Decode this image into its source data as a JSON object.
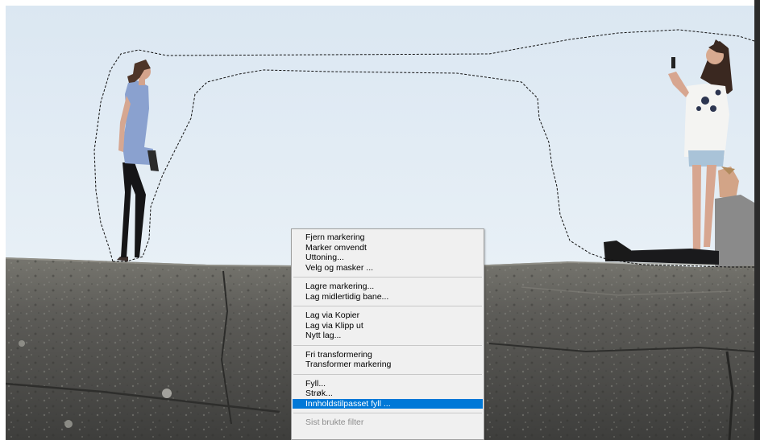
{
  "context_menu": {
    "groups": [
      {
        "items": [
          {
            "label": "Fjern markering"
          },
          {
            "label": "Marker omvendt"
          },
          {
            "label": "Uttoning..."
          },
          {
            "label": "Velg og masker ..."
          }
        ]
      },
      {
        "items": [
          {
            "label": "Lagre markering..."
          },
          {
            "label": "Lag midlertidig bane..."
          }
        ]
      },
      {
        "items": [
          {
            "label": "Lag via Kopier"
          },
          {
            "label": "Lag via Klipp ut"
          },
          {
            "label": "Nytt lag..."
          }
        ]
      },
      {
        "items": [
          {
            "label": "Fri transformering"
          },
          {
            "label": "Transformer markering"
          }
        ]
      },
      {
        "items": [
          {
            "label": "Fyll..."
          },
          {
            "label": "Strøk..."
          },
          {
            "label": "Innholdstilpasset fyll ...",
            "highlighted": true
          }
        ]
      },
      {
        "items": [
          {
            "label": "Sist brukte filter",
            "disabled": true
          }
        ]
      }
    ]
  },
  "colors": {
    "sky_top": "#dce8f3",
    "sky_bottom": "#e6eff6",
    "rock": "#5f5f5c",
    "menu_bg": "#f0f0f0",
    "menu_highlight": "#0078d7",
    "menu_border": "#a0a0a0"
  }
}
